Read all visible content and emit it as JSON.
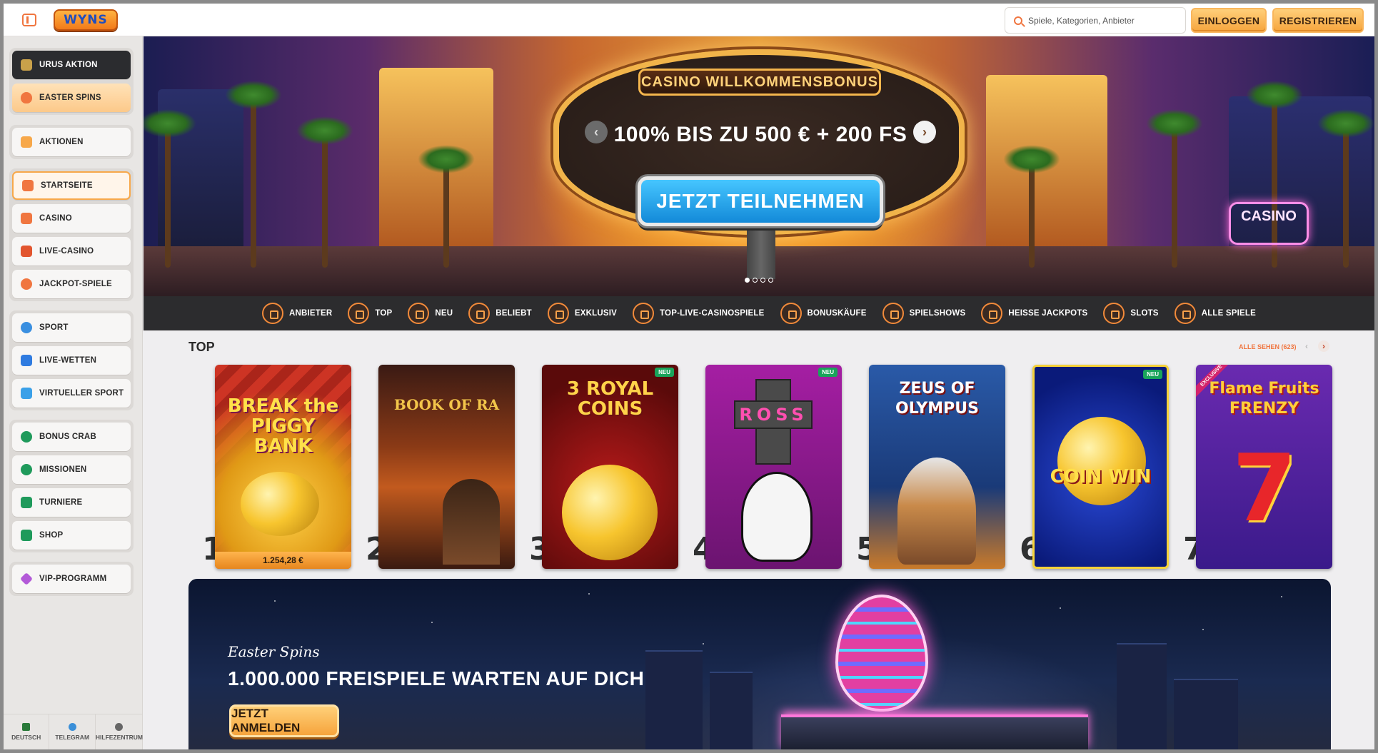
{
  "header": {
    "logo_text": "WYNS",
    "search_placeholder": "Spiele, Kategorien, Anbieter",
    "login_label": "EINLOGGEN",
    "register_label": "REGISTRIEREN"
  },
  "sidebar": {
    "promo_items": [
      {
        "label": "URUS AKTION",
        "icon": "car-icon"
      },
      {
        "label": "EASTER SPINS",
        "icon": "egg-icon"
      }
    ],
    "promotions_item": {
      "label": "AKTIONEN",
      "icon": "gift-icon"
    },
    "casino_items": [
      {
        "label": "STARTSEITE",
        "icon": "home-icon"
      },
      {
        "label": "CASINO",
        "icon": "slot-machine-icon"
      },
      {
        "label": "LIVE-CASINO",
        "icon": "cards-icon"
      },
      {
        "label": "JACKPOT-SPIELE",
        "icon": "jackpot-icon"
      }
    ],
    "sport_items": [
      {
        "label": "SPORT",
        "icon": "basketball-icon"
      },
      {
        "label": "LIVE-WETTEN",
        "icon": "live-icon"
      },
      {
        "label": "VIRTUELLER SPORT",
        "icon": "monitor-icon"
      }
    ],
    "extra_items": [
      {
        "label": "BONUS CRAB",
        "icon": "crab-icon"
      },
      {
        "label": "MISSIONEN",
        "icon": "target-icon"
      },
      {
        "label": "TURNIERE",
        "icon": "trophy-icon"
      },
      {
        "label": "SHOP",
        "icon": "basket-icon"
      }
    ],
    "vip_item": {
      "label": "VIP-PROGRAMM",
      "icon": "diamond-icon"
    },
    "footer": [
      {
        "label": "DEUTSCH",
        "icon": "flag-icon"
      },
      {
        "label": "TELEGRAM",
        "icon": "telegram-icon"
      },
      {
        "label": "HILFEZENTRUM",
        "icon": "help-icon"
      }
    ]
  },
  "hero": {
    "sign_title": "CASINO WILLKOMMENSBONUS",
    "bonus_text": "100% BIS ZU 500 € + 200 FS",
    "cta_label": "JETZT TEILNEHMEN",
    "neon_sign": "CASINO",
    "slide_count": 4,
    "active_slide": 1
  },
  "categories": [
    {
      "label": "ANBIETER",
      "icon": "provider-icon"
    },
    {
      "label": "TOP",
      "icon": "crown-icon"
    },
    {
      "label": "NEU",
      "icon": "lightning-icon"
    },
    {
      "label": "BELIEBT",
      "icon": "fire-icon"
    },
    {
      "label": "EXKLUSIV",
      "icon": "diamond-icon"
    },
    {
      "label": "TOP-LIVE-CASINOSPIELE",
      "icon": "star-icon"
    },
    {
      "label": "BONUSKÄUFE",
      "icon": "gift-icon"
    },
    {
      "label": "SPIELSHOWS",
      "icon": "microphone-icon"
    },
    {
      "label": "HEISSE JACKPOTS",
      "icon": "hot-jackpot-icon"
    },
    {
      "label": "SLOTS",
      "icon": "slot-icon"
    },
    {
      "label": "ALLE SPIELE",
      "icon": "cherries-icon"
    }
  ],
  "top_section": {
    "title": "TOP",
    "see_all": "ALLE SEHEN (623)",
    "games": [
      {
        "rank": "1",
        "title": "BREAK the PIGGY BANK",
        "jackpot": "1.254,28 €",
        "badge": ""
      },
      {
        "rank": "2",
        "title": "BOOK OF RA",
        "badge": ""
      },
      {
        "rank": "3",
        "title": "3 ROYAL COINS",
        "badge": "NEU"
      },
      {
        "rank": "4",
        "title": "ROSS",
        "badge": "NEU"
      },
      {
        "rank": "5",
        "title": "ZEUS OF OLYMPUS",
        "badge": ""
      },
      {
        "rank": "6",
        "title": "COIN WIN",
        "badge": "NEU"
      },
      {
        "rank": "7",
        "title": "Flame Fruits FRENZY",
        "badge": "EXCLUSIVE"
      }
    ]
  },
  "promo": {
    "subtitle": "Easter Spins",
    "title": "1.000.000 FREISPIELE WARTEN AUF DICH",
    "cta_label": "JETZT ANMELDEN"
  },
  "colors": {
    "accent": "#f07640",
    "button_gold": "#f6a53d",
    "hero_cta": "#138ad8",
    "new_badge": "#19a45b"
  }
}
